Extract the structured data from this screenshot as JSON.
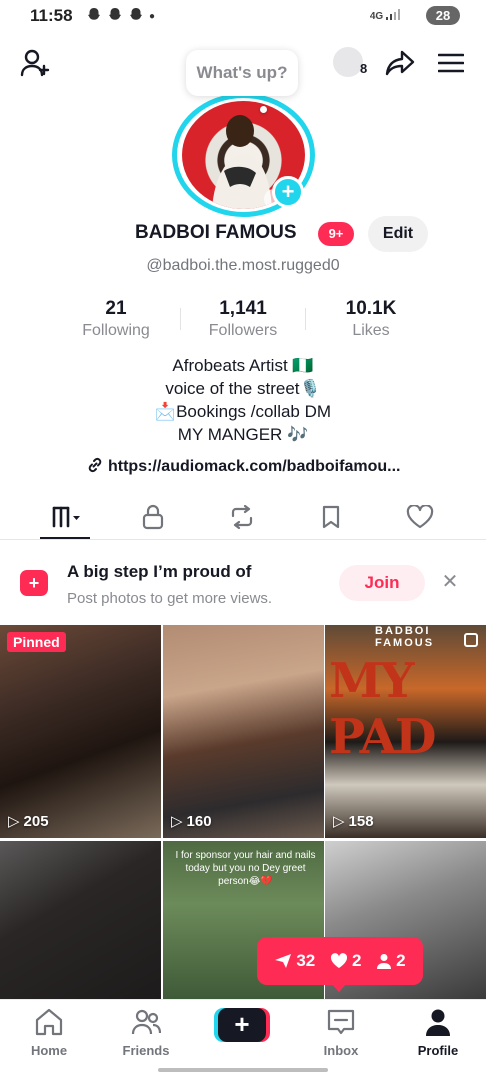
{
  "status_bar": {
    "time": "11:58",
    "network": "4G",
    "battery": "28"
  },
  "header": {
    "add_friend_icon": "person-plus-icon",
    "friends_count": "8",
    "share_icon": "share-icon",
    "menu_icon": "hamburger-icon"
  },
  "profile": {
    "whats_up": "What's up?",
    "name": "BADBOI FAMOUS",
    "notification_badge": "9+",
    "edit_label": "Edit",
    "handle": "@badboi.the.most.rugged0"
  },
  "stats": [
    {
      "value": "21",
      "label": "Following"
    },
    {
      "value": "1,141",
      "label": "Followers"
    },
    {
      "value": "10.1K",
      "label": "Likes"
    }
  ],
  "bio": {
    "line1": "Afrobeats Artist 🇳🇬",
    "line2": "voice of the street🎙️",
    "line3": "📩Bookings /collab DM",
    "line4": "MY MANGER 🎶",
    "link": "https://audiomack.com/badboifamou..."
  },
  "promo": {
    "title": "A big step I’m proud of",
    "subtitle": "Post photos to get more views.",
    "join_label": "Join"
  },
  "videos": [
    {
      "views": "205",
      "pinned_label": "Pinned"
    },
    {
      "views": "160"
    },
    {
      "views": "158",
      "overlay_title": "BADBOI FAMOUS",
      "overlay_big": "MY PAD"
    },
    {
      "views": ""
    },
    {
      "views": "",
      "caption": "I for sponsor your hair and nails today but you no Dey greet person😂💔"
    },
    {
      "views": ""
    }
  ],
  "activity": {
    "views": "32",
    "likes": "2",
    "followers": "2"
  },
  "nav": {
    "home": "Home",
    "friends": "Friends",
    "inbox": "Inbox",
    "profile": "Profile"
  }
}
